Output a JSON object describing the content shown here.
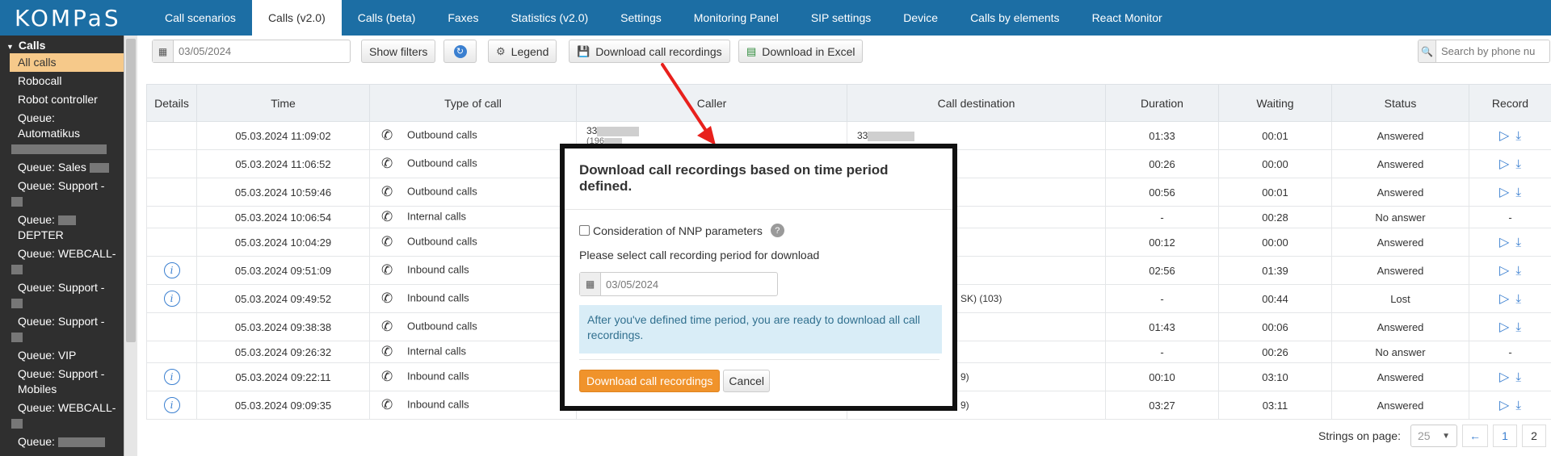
{
  "app": {
    "logo_text": "KOMPaS"
  },
  "nav": {
    "tabs": [
      {
        "label": "Call scenarios"
      },
      {
        "label": "Calls (v2.0)",
        "active": true
      },
      {
        "label": "Calls (beta)"
      },
      {
        "label": "Faxes"
      },
      {
        "label": "Statistics (v2.0)"
      },
      {
        "label": "Settings"
      },
      {
        "label": "Monitoring Panel"
      },
      {
        "label": "SIP settings"
      },
      {
        "label": "Device"
      },
      {
        "label": "Calls by elements"
      },
      {
        "label": "React Monitor"
      }
    ]
  },
  "sidebar": {
    "section": "Calls",
    "items": [
      {
        "label": "All calls",
        "active": true
      },
      {
        "label": "Robocall"
      },
      {
        "label": "Robot controller"
      },
      {
        "label": "Queue: Automatikus"
      },
      {
        "label": "Queue: Sales"
      },
      {
        "label": "Queue: Support -"
      },
      {
        "label": "Queue:"
      },
      {
        "label": "DEPTER"
      },
      {
        "label": "Queue: WEBCALL-"
      },
      {
        "label": "Queue: Support -"
      },
      {
        "label": "Queue: Support -"
      },
      {
        "label": "Queue: VIP"
      },
      {
        "label": "Queue: Support -"
      },
      {
        "label": "Mobiles"
      },
      {
        "label": "Queue: WEBCALL-"
      },
      {
        "label": "Queue:"
      }
    ]
  },
  "toolbar": {
    "date_value": "03/05/2024",
    "show_filters": "Show filters",
    "legend": "Legend",
    "download_recordings": "Download call recordings",
    "download_excel": "Download in Excel",
    "search_placeholder": "Search by phone nu"
  },
  "table": {
    "headers": [
      "Details",
      "Time",
      "Type of call",
      "Caller",
      "Call destination",
      "Duration",
      "Waiting",
      "Status",
      "Record"
    ],
    "rows": [
      {
        "info": false,
        "time": "05.03.2024 11:09:02",
        "type": "Outbound calls",
        "caller": "33",
        "caller_sub": "(196",
        "dest": "33",
        "dest_suffix": "",
        "duration": "01:33",
        "waiting": "00:01",
        "status": "Answered",
        "record": true,
        "size": "tall"
      },
      {
        "info": false,
        "time": "05.03.2024 11:06:52",
        "type": "Outbound calls",
        "caller": "",
        "caller_sub": "",
        "dest": "",
        "dest_suffix": "",
        "duration": "00:26",
        "waiting": "00:00",
        "status": "Answered",
        "record": true,
        "size": "tall"
      },
      {
        "info": false,
        "time": "05.03.2024 10:59:46",
        "type": "Outbound calls",
        "caller": "",
        "caller_sub": "",
        "dest": "",
        "dest_suffix": "",
        "duration": "00:56",
        "waiting": "00:01",
        "status": "Answered",
        "record": true,
        "size": "tall"
      },
      {
        "info": false,
        "time": "05.03.2024 10:06:54",
        "type": "Internal calls",
        "caller": "",
        "caller_sub": "",
        "dest": "",
        "dest_suffix": "",
        "duration": "-",
        "waiting": "00:28",
        "status": "No answer",
        "record": false,
        "size": "short"
      },
      {
        "info": false,
        "time": "05.03.2024 10:04:29",
        "type": "Outbound calls",
        "caller": "",
        "caller_sub": "",
        "dest": "",
        "dest_suffix": "",
        "duration": "00:12",
        "waiting": "00:00",
        "status": "Answered",
        "record": true,
        "size": "tall"
      },
      {
        "info": true,
        "time": "05.03.2024 09:51:09",
        "type": "Inbound calls",
        "caller": "",
        "caller_sub": "",
        "dest": "",
        "dest_suffix": "",
        "duration": "02:56",
        "waiting": "01:39",
        "status": "Answered",
        "record": true,
        "size": "tall"
      },
      {
        "info": true,
        "time": "05.03.2024 09:49:52",
        "type": "Inbound calls",
        "caller": "",
        "caller_sub": "",
        "dest": "",
        "dest_suffix": "SK) (103)",
        "duration": "-",
        "waiting": "00:44",
        "status": "Lost",
        "record": true,
        "size": "tall"
      },
      {
        "info": false,
        "time": "05.03.2024 09:38:38",
        "type": "Outbound calls",
        "caller": "",
        "caller_sub": "",
        "dest": "",
        "dest_suffix": "",
        "duration": "01:43",
        "waiting": "00:06",
        "status": "Answered",
        "record": true,
        "size": "tall"
      },
      {
        "info": false,
        "time": "05.03.2024 09:26:32",
        "type": "Internal calls",
        "caller": "",
        "caller_sub": "",
        "dest": "",
        "dest_suffix": "",
        "duration": "-",
        "waiting": "00:26",
        "status": "No answer",
        "record": false,
        "size": "short"
      },
      {
        "info": true,
        "time": "05.03.2024 09:22:11",
        "type": "Inbound calls",
        "caller": "",
        "caller_sub": "",
        "dest": "",
        "dest_suffix": "9)",
        "duration": "00:10",
        "waiting": "03:10",
        "status": "Answered",
        "record": true,
        "size": "tall"
      },
      {
        "info": true,
        "time": "05.03.2024 09:09:35",
        "type": "Inbound calls",
        "caller": "",
        "caller_sub": "",
        "dest": "",
        "dest_suffix": "9)",
        "duration": "03:27",
        "waiting": "03:11",
        "status": "Answered",
        "record": true,
        "size": "tall"
      }
    ],
    "no_record_mark": "-"
  },
  "pager": {
    "label": "Strings on page:",
    "per_page": "25",
    "prev": "←",
    "pages": [
      "1",
      "2"
    ]
  },
  "modal": {
    "title": "Download call recordings based on time period defined.",
    "nnp_label": "Consideration of NNP parameters",
    "help": "?",
    "prompt": "Please select call recording period for download",
    "date_value": "03/05/2024",
    "info": "After you've defined time period, you are ready to download all call recordings.",
    "primary": "Download call recordings",
    "cancel": "Cancel"
  },
  "colors": {
    "nav_bg": "#1c6ea4",
    "sidebar_bg": "#2f2f2f",
    "active_item": "#f6c98a",
    "accent": "#3a7fd0",
    "primary_button": "#f0932b",
    "info_bg": "#d9edf7",
    "arrow": "#e8201c"
  }
}
